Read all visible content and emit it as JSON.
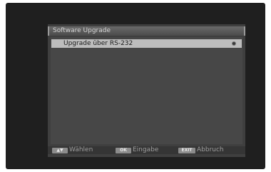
{
  "window": {
    "title": "Software Upgrade"
  },
  "menu": {
    "items": [
      {
        "label": "Upgrade über RS-232",
        "icon": "radio-dot-icon",
        "selected": true
      }
    ]
  },
  "footer": {
    "select": {
      "key": "▲▼",
      "key_icon": "up-down-arrows-icon",
      "label": "Wählen"
    },
    "enter": {
      "key": "OK",
      "label": "Eingabe"
    },
    "exit": {
      "key": "EXIT",
      "label": "Abbruch"
    }
  },
  "colors": {
    "screen_bg": "#1f1f1f",
    "window_bg": "#3f3f3f",
    "highlight": "#bdbdbd"
  }
}
